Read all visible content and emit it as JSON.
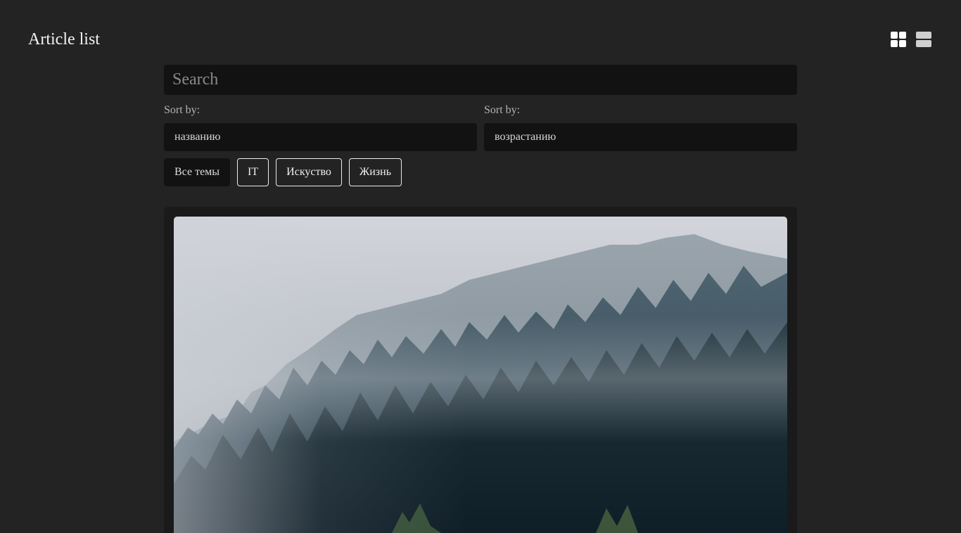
{
  "header": {
    "title": "Article list",
    "view_toggle": [
      {
        "name": "grid-view",
        "icon": "grid-icon",
        "color": "#ffffff"
      },
      {
        "name": "list-view",
        "icon": "list-icon",
        "color": "#cfcfcf"
      }
    ]
  },
  "search": {
    "placeholder": "Search",
    "value": ""
  },
  "sort": {
    "field": {
      "label": "Sort by:",
      "selected": "названию"
    },
    "order": {
      "label": "Sort by:",
      "selected": "возрастанию"
    }
  },
  "topics": [
    {
      "label": "Все темы",
      "active": true
    },
    {
      "label": "IT",
      "active": false
    },
    {
      "label": "Искуство",
      "active": false
    },
    {
      "label": "Жизнь",
      "active": false
    }
  ],
  "articles": [
    {
      "image": "foggy-forest-photo"
    }
  ],
  "colors": {
    "background": "#232323",
    "input_background": "#121212",
    "card_background": "#1a1a1a"
  }
}
